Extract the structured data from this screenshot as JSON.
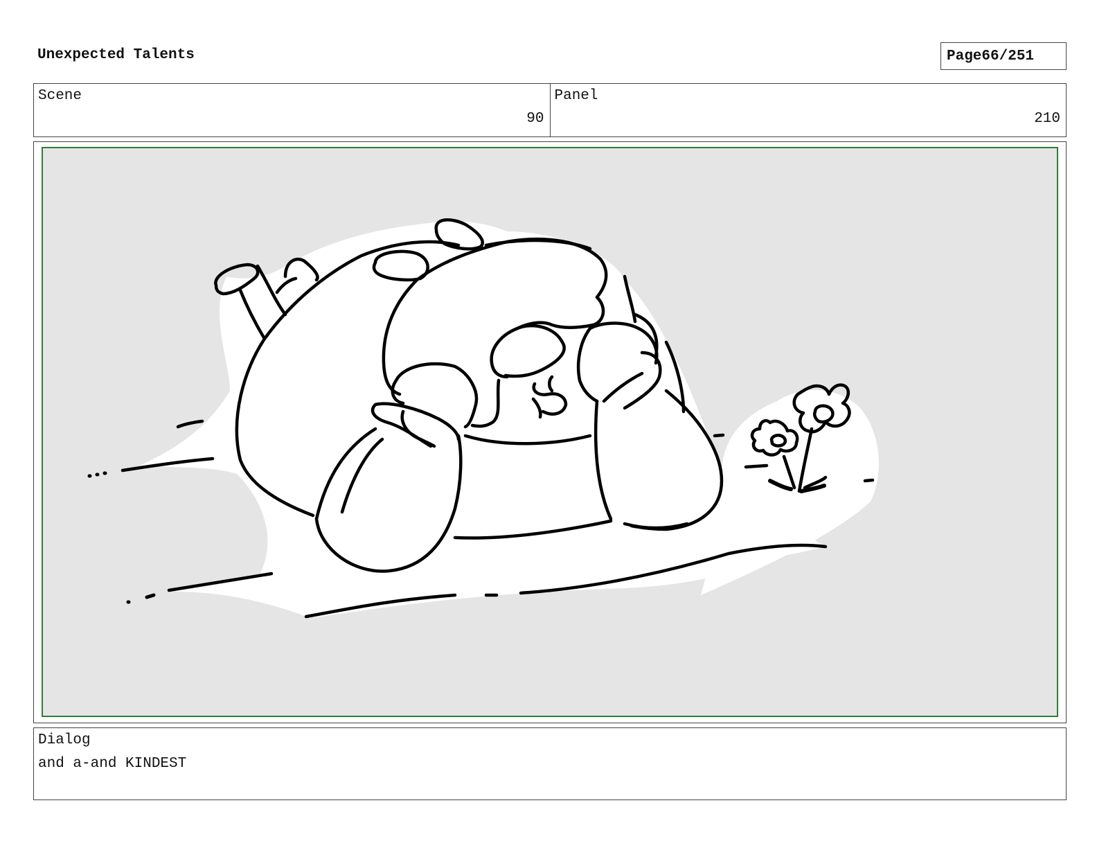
{
  "header": {
    "title": "Unexpected Talents",
    "page_label": "Page",
    "page_number": "66/251"
  },
  "info": {
    "scene_label": "Scene",
    "scene_value": "90",
    "panel_label": "Panel",
    "panel_value": "210"
  },
  "dialog": {
    "label": "Dialog",
    "text": "and a-and KINDEST"
  },
  "colors": {
    "frame_border": "#2e7d32",
    "panel_background": "#e5e5e5",
    "ink": "#000000"
  }
}
